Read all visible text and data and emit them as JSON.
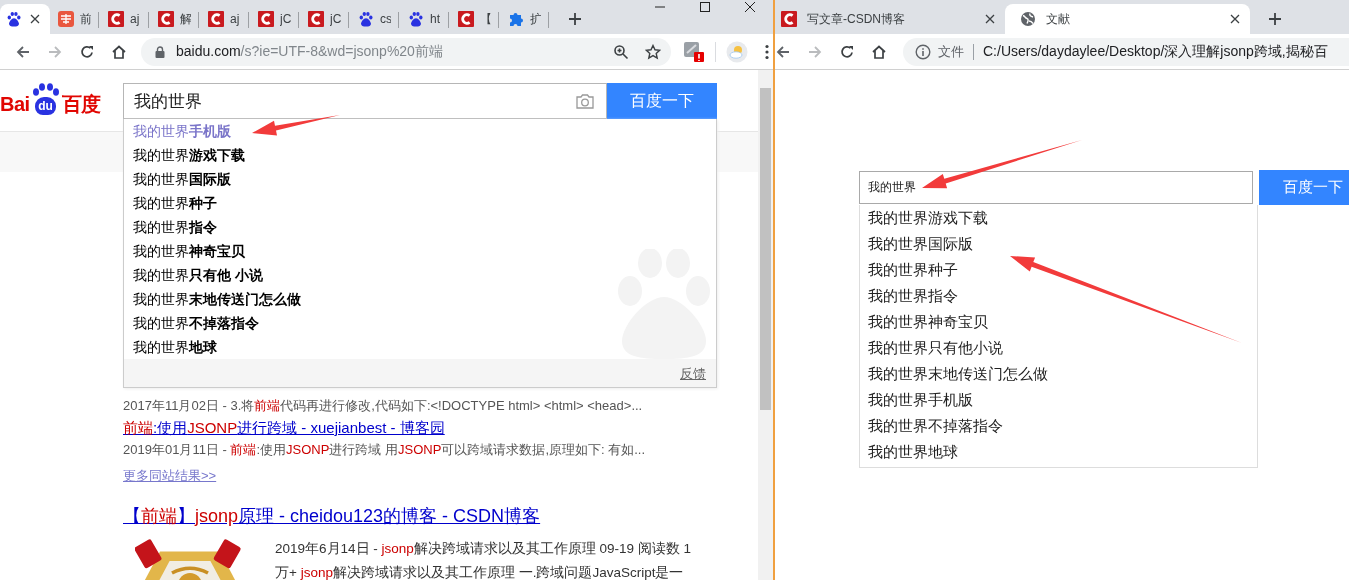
{
  "left_window": {
    "tabs": [
      {
        "kind": "paw",
        "selected": true
      },
      {
        "kind": "jian",
        "title": "前",
        "selected": false
      },
      {
        "kind": "csdn",
        "title": "aj",
        "selected": false
      },
      {
        "kind": "csdn",
        "title": "解",
        "selected": false
      },
      {
        "kind": "csdn",
        "title": "aj",
        "selected": false
      },
      {
        "kind": "csdn",
        "title": "jC",
        "selected": false
      },
      {
        "kind": "csdn",
        "title": "jC",
        "selected": false
      },
      {
        "kind": "paw",
        "title": "cs",
        "selected": false
      },
      {
        "kind": "paw",
        "title": "ht",
        "selected": false
      },
      {
        "kind": "csdn",
        "title": "【",
        "selected": false
      },
      {
        "kind": "puzzle",
        "title": "扩",
        "selected": false
      }
    ],
    "address": {
      "host": "baidu.com",
      "path": "/s?ie=UTF-8&wd=jsonp%20前端"
    },
    "logo": [
      "Bai",
      "du",
      "百度"
    ],
    "search": {
      "value": "我的世界",
      "button": "百度一下"
    },
    "suggestions": [
      {
        "text": "我的世界**手机版**",
        "selected": true
      },
      {
        "text": "我的世界**游戏下载**",
        "selected": false
      },
      {
        "text": "我的世界**国际版**",
        "selected": false
      },
      {
        "text": "我的世界**种子**",
        "selected": false
      },
      {
        "text": "我的世界**指令**",
        "selected": false
      },
      {
        "text": "我的世界**神奇宝贝**",
        "selected": false
      },
      {
        "text": "我的世界**只有他 小说**",
        "selected": false
      },
      {
        "text": "我的世界**末地传送门怎么做**",
        "selected": false
      },
      {
        "text": "我的世界**不掉落指令**",
        "selected": false
      },
      {
        "text": "我的世界**地球**",
        "selected": false
      }
    ],
    "feedback": "反馈",
    "results": [
      {
        "kind": "snippet",
        "parts": [
          {
            "text": "2017年11月02日 - 3.将",
            "highlight": false
          },
          {
            "text": "前端",
            "highlight": true
          },
          {
            "text": "代码再进行修改,代码如下:<!DOCTYPE html> <html> <head>...",
            "highlight": false
          }
        ]
      },
      {
        "kind": "link",
        "parts": [
          {
            "text": "前端",
            "highlight": true
          },
          {
            "text": ":使用",
            "highlight": false
          },
          {
            "text": "JSONP",
            "highlight": true
          },
          {
            "text": "进行跨域 - xuejianbest - 博客园",
            "highlight": false
          }
        ]
      },
      {
        "kind": "snippet",
        "parts": [
          {
            "text": "2019年01月11日 - ",
            "highlight": false
          },
          {
            "text": "前端",
            "highlight": true
          },
          {
            "text": ":使用",
            "highlight": false
          },
          {
            "text": "JSONP",
            "highlight": true
          },
          {
            "text": "进行跨域 用",
            "highlight": false
          },
          {
            "text": "JSONP",
            "highlight": true
          },
          {
            "text": "可以跨域请求数据,原理如下: 有如...",
            "highlight": false
          }
        ]
      },
      {
        "kind": "more",
        "parts": [
          {
            "text": "更多同站结果>>",
            "highlight": false
          }
        ]
      },
      {
        "kind": "title",
        "parts": [
          {
            "text": "【",
            "highlight": false
          },
          {
            "text": "前端",
            "highlight": true
          },
          {
            "text": "】",
            "highlight": false
          },
          {
            "text": "jsonp",
            "highlight": true
          },
          {
            "text": "原理 - cheidou123的博客 - CSDN博客",
            "highlight": false
          }
        ]
      },
      {
        "kind": "image_snippet",
        "parts": [
          {
            "text": "2019年6月14日 - ",
            "highlight": false
          },
          {
            "text": "jsonp",
            "highlight": true
          },
          {
            "text": "解决跨域请求以及其工作原理 09-19 阅读数 1万+ ",
            "highlight": false
          },
          {
            "text": "jsonp",
            "highlight": true
          },
          {
            "text": "解决跨域请求以及其工作原理  一.跨域问题JavaScript是一",
            "highlight": false
          }
        ]
      }
    ]
  },
  "right_window": {
    "tabs": [
      {
        "kind": "csdn",
        "title": "写文章-CSDN博客",
        "selected": false
      },
      {
        "kind": "globe",
        "title": "文献",
        "selected": true
      }
    ],
    "address": {
      "label": "文件",
      "url": "C:/Users/daydaylee/Desktop/深入理解jsonp跨域,揭秘百"
    },
    "search": {
      "value": "我的世界",
      "button": "百度一下"
    },
    "suggestions": [
      "我的世界游戏下载",
      "我的世界国际版",
      "我的世界种子",
      "我的世界指令",
      "我的世界神奇宝贝",
      "我的世界只有他小说",
      "我的世界末地传送门怎么做",
      "我的世界手机版",
      "我的世界不掉落指令",
      "我的世界地球"
    ]
  }
}
